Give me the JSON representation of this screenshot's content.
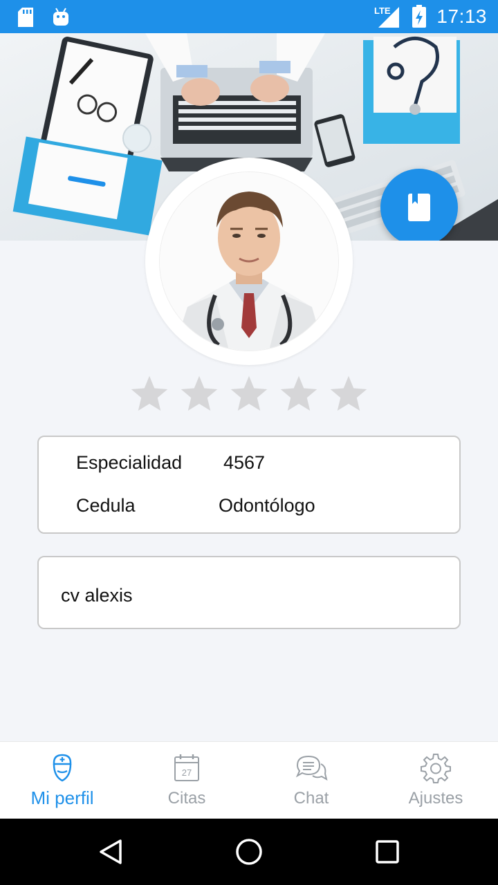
{
  "status_bar": {
    "time": "17:13",
    "network": "LTE",
    "icons": [
      "sd-card-icon",
      "android-icon",
      "lte-signal-icon",
      "battery-charging-icon"
    ]
  },
  "header": {
    "image": "doctor-desk-header-image",
    "fab_icon": "book-icon"
  },
  "profile": {
    "avatar": "doctor-portrait",
    "rating": 0,
    "max_rating": 5,
    "info": [
      {
        "label": "Especialidad",
        "value": "4567"
      },
      {
        "label": "Cedula",
        "value": "Odontólogo"
      }
    ],
    "cv_text": "cv alexis"
  },
  "bottom_nav": {
    "items": [
      {
        "label": "Mi perfil",
        "icon": "doctor-icon",
        "active": true
      },
      {
        "label": "Citas",
        "icon": "calendar-icon",
        "active": false
      },
      {
        "label": "Chat",
        "icon": "chat-bubbles-icon",
        "active": false
      },
      {
        "label": "Ajustes",
        "icon": "gear-icon",
        "active": false
      }
    ],
    "calendar_day": "27"
  },
  "colors": {
    "accent": "#1e90e9",
    "star_empty": "#d6d6d8",
    "background": "#f3f5f9",
    "nav_inactive": "#9aa0a6"
  }
}
